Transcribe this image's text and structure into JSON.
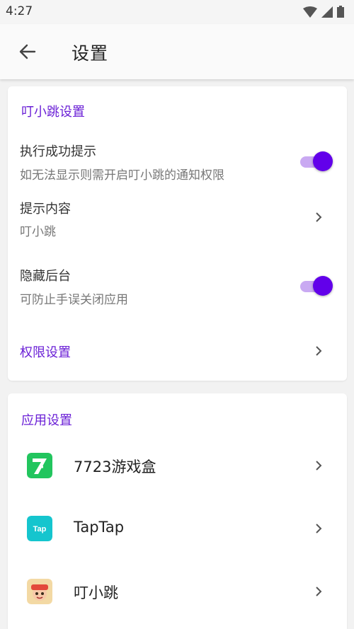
{
  "status": {
    "time": "4:27"
  },
  "header": {
    "title": "设置"
  },
  "card1": {
    "section_title": "叮小跳设置",
    "success_tip": {
      "title": "执行成功提示",
      "subtitle": "如无法显示则需开启叮小跳的通知权限",
      "enabled": true
    },
    "tip_content": {
      "title": "提示内容",
      "value": "叮小跳"
    },
    "hide_background": {
      "title": "隐藏后台",
      "subtitle": "可防止手误关闭应用",
      "enabled": true
    },
    "permissions": {
      "label": "权限设置"
    }
  },
  "card2": {
    "section_title": "应用设置",
    "apps": [
      {
        "name": "7723游戏盒",
        "icon": "7723-app-icon"
      },
      {
        "name": "TapTap",
        "icon": "taptap-app-icon",
        "icon_text": "Tap"
      },
      {
        "name": "叮小跳",
        "icon": "dingxiaotiao-app-icon"
      }
    ]
  },
  "colors": {
    "accent": "#6200ea",
    "section": "#6a1fd6",
    "track": "#c9a9f2"
  }
}
